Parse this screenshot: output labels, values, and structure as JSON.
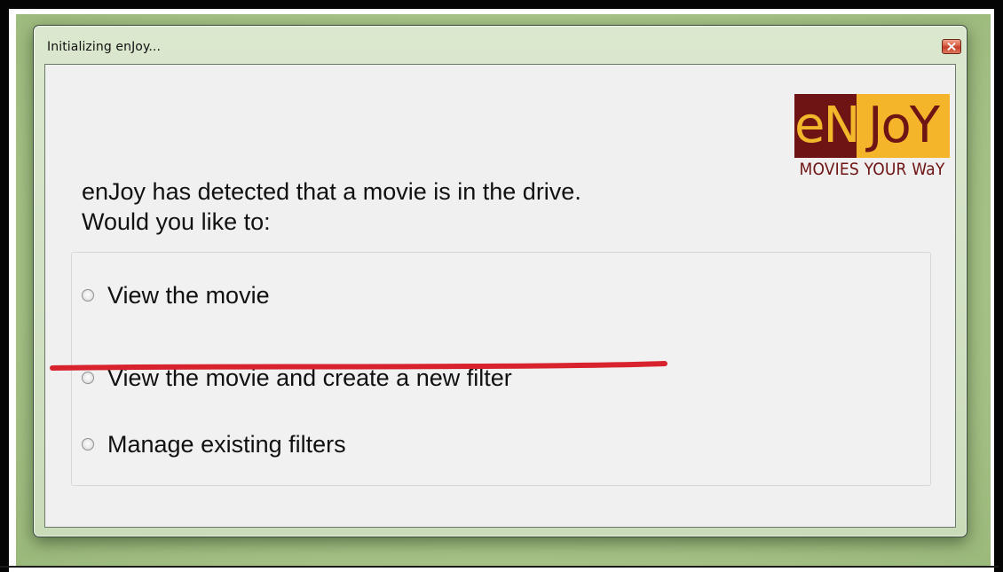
{
  "window": {
    "title": "Initializing enJoy...",
    "close_label": "Close"
  },
  "logo": {
    "brand_part1": "eN",
    "brand_part2": "JoY",
    "tagline": "MOVIES YOUR WaY"
  },
  "prompt": {
    "line1": "enJoy has detected that a movie is in the drive.",
    "line2": "Would you like to:"
  },
  "options": [
    {
      "label": "View the movie",
      "selected": false,
      "struck": false
    },
    {
      "label": "View the movie and create a new filter",
      "selected": false,
      "struck": true
    },
    {
      "label": "Manage existing filters",
      "selected": false,
      "struck": false
    }
  ],
  "colors": {
    "logo_maroon": "#6e1414",
    "logo_gold": "#f4b52a",
    "strike_red": "#d8232f",
    "backdrop_green": "#aac58a"
  },
  "icons": {
    "close": "close-icon"
  }
}
